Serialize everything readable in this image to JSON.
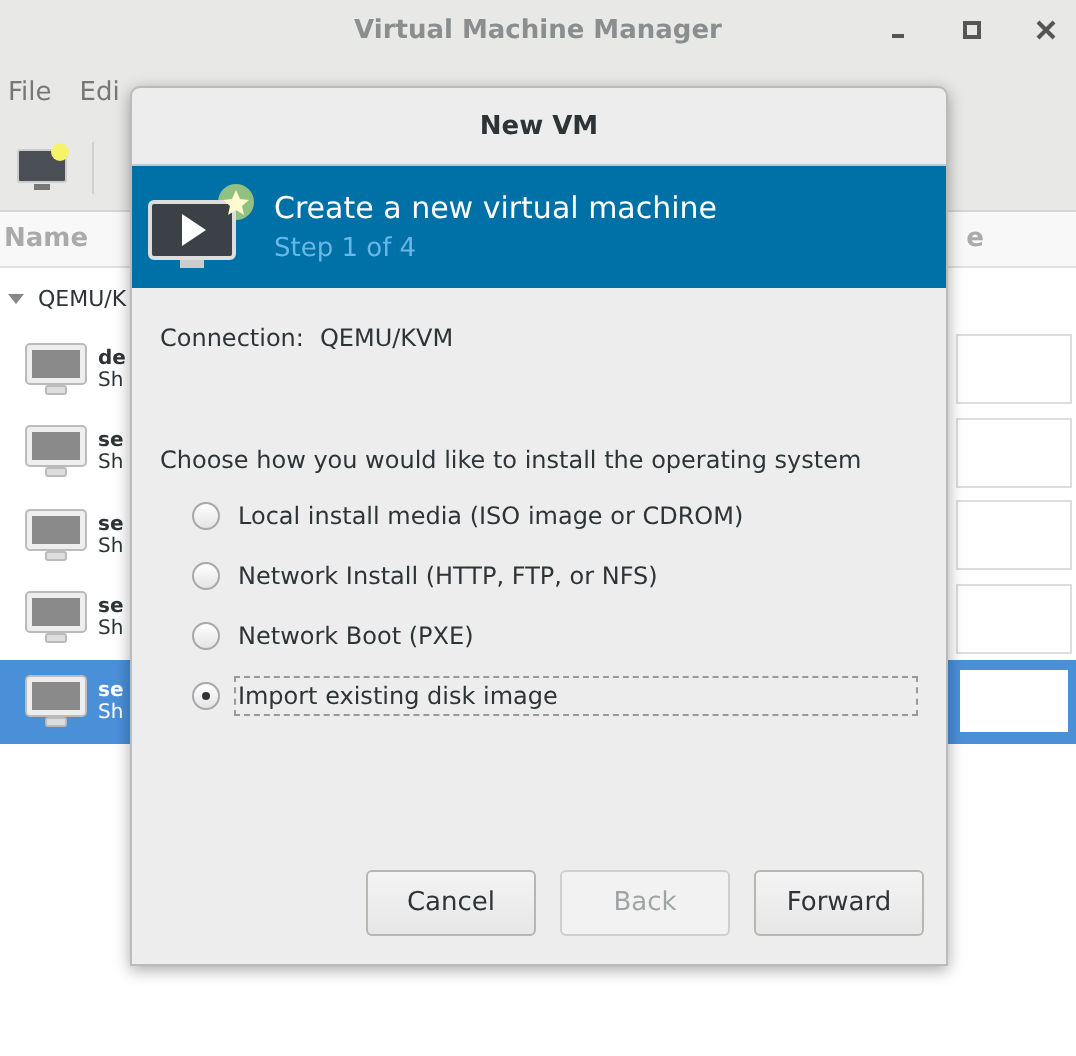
{
  "window": {
    "title": "Virtual Machine Manager"
  },
  "menu": [
    "File",
    "Edi"
  ],
  "columns": [
    "Name",
    "e"
  ],
  "connection": {
    "label": "QEMU/K",
    "expanded": true
  },
  "vms": [
    {
      "name": "de",
      "status": "Sh",
      "selected": false
    },
    {
      "name": "se",
      "status": "Sh",
      "selected": false
    },
    {
      "name": "se",
      "status": "Sh",
      "selected": false
    },
    {
      "name": "se",
      "status": "Sh",
      "selected": false
    },
    {
      "name": "se",
      "status": "Sh",
      "selected": true
    }
  ],
  "dialog": {
    "title": "New VM",
    "heading": "Create a new virtual machine",
    "step": "Step 1 of 4",
    "connection_label": "Connection:",
    "connection_value": "QEMU/KVM",
    "prompt": "Choose how you would like to install the operating system",
    "options": [
      {
        "label": "Local install media (ISO image or CDROM)",
        "selected": false
      },
      {
        "label": "Network Install (HTTP, FTP, or NFS)",
        "selected": false
      },
      {
        "label": "Network Boot (PXE)",
        "selected": false
      },
      {
        "label": "Import existing disk image",
        "selected": true
      }
    ],
    "buttons": [
      {
        "label": "Cancel",
        "disabled": false
      },
      {
        "label": "Back",
        "disabled": true
      },
      {
        "label": "Forward",
        "disabled": false
      }
    ]
  }
}
